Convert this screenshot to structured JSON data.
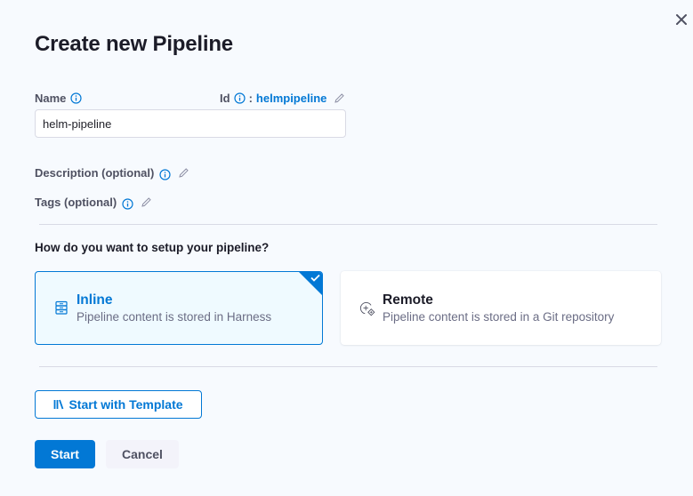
{
  "dialog": {
    "title": "Create new Pipeline",
    "close_icon": "close-icon"
  },
  "form": {
    "name": {
      "label": "Name",
      "value": "helm-pipeline",
      "placeholder": ""
    },
    "id": {
      "label": "Id",
      "separator": ":",
      "value": "helmpipeline"
    },
    "description": {
      "label": "Description (optional)"
    },
    "tags": {
      "label": "Tags (optional)"
    }
  },
  "setup": {
    "question": "How do you want to setup your pipeline?",
    "options": [
      {
        "title": "Inline",
        "description": "Pipeline content is stored in Harness",
        "icon": "inline-storage-icon",
        "selected": true
      },
      {
        "title": "Remote",
        "description": "Pipeline content is stored in a Git repository",
        "icon": "remote-git-icon",
        "selected": false
      }
    ]
  },
  "actions": {
    "template_label": "Start with Template",
    "start_label": "Start",
    "cancel_label": "Cancel"
  },
  "colors": {
    "accent": "#0278d5",
    "selected_card_bg": "#effaff",
    "page_bg": "#f7fafe"
  }
}
